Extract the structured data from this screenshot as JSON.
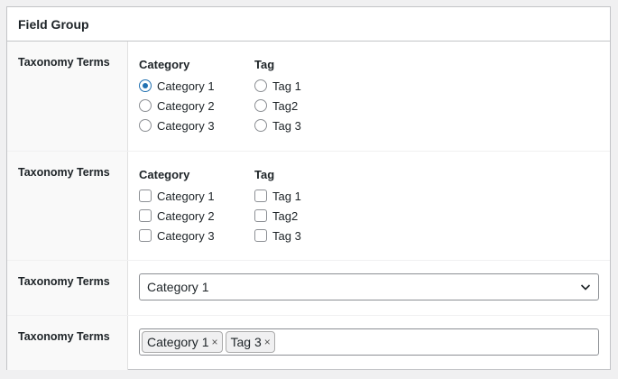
{
  "panel": {
    "title": "Field Group"
  },
  "rows": [
    {
      "label": "Taxonomy Terms",
      "type": "radio",
      "columns": [
        {
          "title": "Category",
          "options": [
            {
              "label": "Category 1",
              "checked": true
            },
            {
              "label": "Category 2",
              "checked": false
            },
            {
              "label": "Category 3",
              "checked": false
            }
          ]
        },
        {
          "title": "Tag",
          "options": [
            {
              "label": "Tag 1",
              "checked": false
            },
            {
              "label": "Tag2",
              "checked": false
            },
            {
              "label": "Tag 3",
              "checked": false
            }
          ]
        }
      ]
    },
    {
      "label": "Taxonomy Terms",
      "type": "checkbox",
      "columns": [
        {
          "title": "Category",
          "options": [
            {
              "label": "Category 1",
              "checked": false
            },
            {
              "label": "Category 2",
              "checked": false
            },
            {
              "label": "Category 3",
              "checked": false
            }
          ]
        },
        {
          "title": "Tag",
          "options": [
            {
              "label": "Tag 1",
              "checked": false
            },
            {
              "label": "Tag2",
              "checked": false
            },
            {
              "label": "Tag 3",
              "checked": false
            }
          ]
        }
      ]
    },
    {
      "label": "Taxonomy Terms",
      "type": "select",
      "selected": "Category 1",
      "icon": "chevron-down-icon"
    },
    {
      "label": "Taxonomy Terms",
      "type": "multiselect",
      "tags": [
        "Category 1",
        "Tag 3"
      ],
      "remove_symbol": "×"
    }
  ],
  "colors": {
    "accent": "#2271b1",
    "border": "#8c8f94",
    "label_bg": "#f9f9f9"
  }
}
